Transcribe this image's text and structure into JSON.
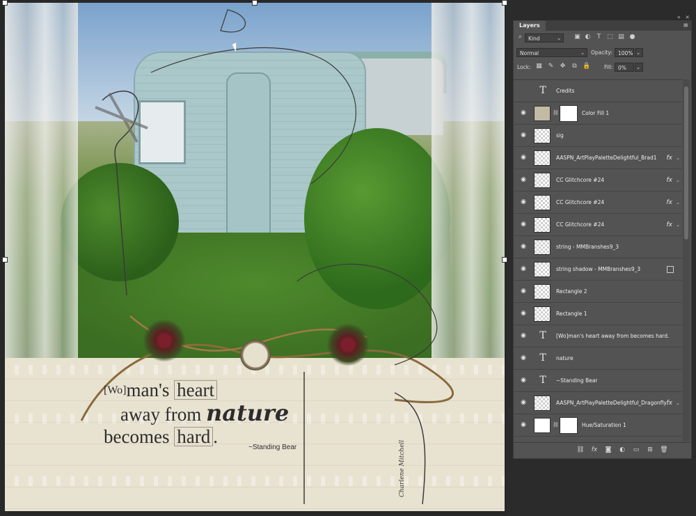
{
  "document": {
    "quote_line1_prefix": "[Wo]",
    "quote_line1_rest": "man's ",
    "quote_line1_box": "heart",
    "quote_line2": "away from ",
    "quote_line2_emph": "nature",
    "quote_line3_pre": "becomes ",
    "quote_line3_box": "hard",
    "quote_line3_end": ".",
    "attribution": "~Standing Bear",
    "signature": "Charlene Mitchell"
  },
  "panel": {
    "tab": "Layers",
    "collapse_glyph": "«",
    "close_glyph": "×",
    "menu_glyph": "≡",
    "filter_kind": "Kind",
    "blend_mode": "Normal",
    "opacity_label": "Opacity:",
    "opacity_value": "100%",
    "lock_label": "Lock:",
    "fill_label": "Fill:",
    "fill_value": "0%"
  },
  "layers": [
    {
      "name": "Credits",
      "kind": "text",
      "visible": false
    },
    {
      "name": "Color Fill 1",
      "kind": "fill",
      "visible": true
    },
    {
      "name": "sig",
      "kind": "pixel",
      "visible": true
    },
    {
      "name": "AASPN_ArtPlayPaletteDelightful_Brad1",
      "kind": "pixel",
      "visible": true,
      "fx": true
    },
    {
      "name": "CC Glitchcore #24",
      "kind": "pixel",
      "visible": true,
      "fx": true
    },
    {
      "name": "CC Glitchcore #24",
      "kind": "pixel",
      "visible": true,
      "fx": true
    },
    {
      "name": "CC Glitchcore #24",
      "kind": "pixel",
      "visible": true,
      "fx": true
    },
    {
      "name": "string - MMBranshes9_3",
      "kind": "pixel",
      "visible": true
    },
    {
      "name": "string shadow - MMBranshes9_3",
      "kind": "pixel",
      "visible": true,
      "smart": true
    },
    {
      "name": "Rectangle 2",
      "kind": "shape",
      "visible": true
    },
    {
      "name": "Rectangle 1",
      "kind": "shape",
      "visible": true
    },
    {
      "name": "[Wo]man's heart    away from becomes hard.",
      "kind": "text",
      "visible": true
    },
    {
      "name": "nature",
      "kind": "text",
      "visible": true
    },
    {
      "name": "~Standing Bear",
      "kind": "text",
      "visible": true
    },
    {
      "name": "AASPN_ArtPlayPaletteDelightful_Dragonfly",
      "kind": "pixel",
      "visible": true,
      "fx": true
    },
    {
      "name": "Hue/Saturation 1",
      "kind": "adjustment",
      "visible": true
    }
  ],
  "icons": {
    "eye": "👁",
    "text_layer": "T",
    "fx": "fx",
    "link": "⛓"
  }
}
